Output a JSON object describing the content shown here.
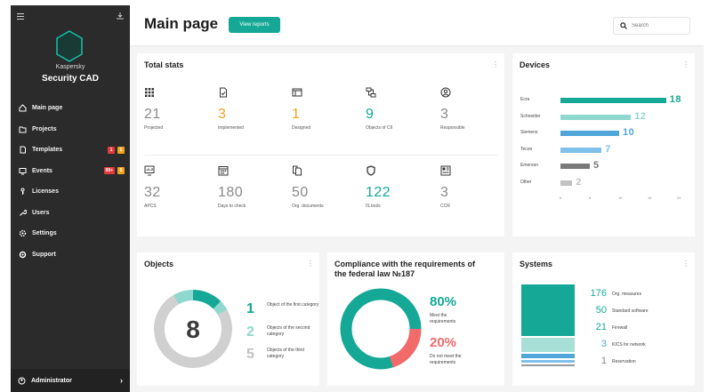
{
  "sidebar": {
    "brand_line1": "Kaspersky",
    "brand_line2": "Security CAD",
    "items": [
      {
        "label": "Main page",
        "icon": "home-icon"
      },
      {
        "label": "Projects",
        "icon": "folder-icon"
      },
      {
        "label": "Templates",
        "icon": "document-icon",
        "badges": [
          "1",
          "5"
        ]
      },
      {
        "label": "Events",
        "icon": "monitor-icon",
        "badges": [
          "99+",
          "5"
        ]
      },
      {
        "label": "Licenses",
        "icon": "key-icon"
      },
      {
        "label": "Users",
        "icon": "wrench-icon"
      },
      {
        "label": "Settings",
        "icon": "gear-icon"
      },
      {
        "label": "Support",
        "icon": "support-icon"
      }
    ],
    "user": "Administrator"
  },
  "header": {
    "title": "Main page",
    "reports_button": "View reports",
    "search_placeholder": "Search"
  },
  "total_stats": {
    "title": "Total stats",
    "items": [
      {
        "value": "21",
        "label": "Projected",
        "color": "gray"
      },
      {
        "value": "3",
        "label": "Implemented",
        "color": "orange"
      },
      {
        "value": "1",
        "label": "Designed",
        "color": "orange"
      },
      {
        "value": "9",
        "label": "Objects of CII",
        "color": "teal"
      },
      {
        "value": "3",
        "label": "Responsible",
        "color": "gray"
      },
      {
        "value": "32",
        "label": "APCS",
        "color": "gray"
      },
      {
        "value": "180",
        "label": "Days to check",
        "color": "gray"
      },
      {
        "value": "50",
        "label": "Org. documents",
        "color": "gray"
      },
      {
        "value": "122",
        "label": "IS tools",
        "color": "teal"
      },
      {
        "value": "3",
        "label": "CCR",
        "color": "gray"
      }
    ]
  },
  "devices": {
    "title": "Devices",
    "items": [
      {
        "name": "Ecra",
        "value": 18,
        "color": "#15a896"
      },
      {
        "name": "Schneider",
        "value": 12,
        "color": "#8fd8cf"
      },
      {
        "name": "Siemens",
        "value": 10,
        "color": "#4fa6d9"
      },
      {
        "name": "Tecon",
        "value": 7,
        "color": "#7fc0ea"
      },
      {
        "name": "Emerson",
        "value": 5,
        "color": "#7a7a7a"
      },
      {
        "name": "Other",
        "value": 2,
        "color": "#c2c2c2"
      }
    ],
    "ticks": [
      "0",
      "5",
      "10",
      "15",
      "20"
    ]
  },
  "objects": {
    "title": "Objects",
    "total": "8",
    "legend": [
      {
        "value": "1",
        "label": "Object of the first category",
        "color": "#15a896"
      },
      {
        "value": "2",
        "label": "Objects of the second category",
        "color": "#8fd8cf"
      },
      {
        "value": "5",
        "label": "Objects of the third category",
        "color": "#c2c2c2"
      }
    ]
  },
  "compliance": {
    "title": "Compliance with the requirements of the  federal law №187",
    "meet_pct": "80%",
    "meet_label": "Meet the requirements",
    "not_meet_pct": "20%",
    "not_meet_label": "Do not meet the requirements",
    "colors": {
      "meet": "#15a896",
      "not_meet": "#f26a6a"
    }
  },
  "systems": {
    "title": "Systems",
    "items": [
      {
        "value": "176",
        "label": "Org. measures",
        "color": "#15a896"
      },
      {
        "value": "50",
        "label": "Standard software",
        "color": "#15a896"
      },
      {
        "value": "21",
        "label": "Firewall",
        "color": "#15a896"
      },
      {
        "value": "3",
        "label": "KICS for network",
        "color": "#4fa6d9"
      },
      {
        "value": "1",
        "label": "Reservation",
        "color": "#888888"
      }
    ]
  }
}
